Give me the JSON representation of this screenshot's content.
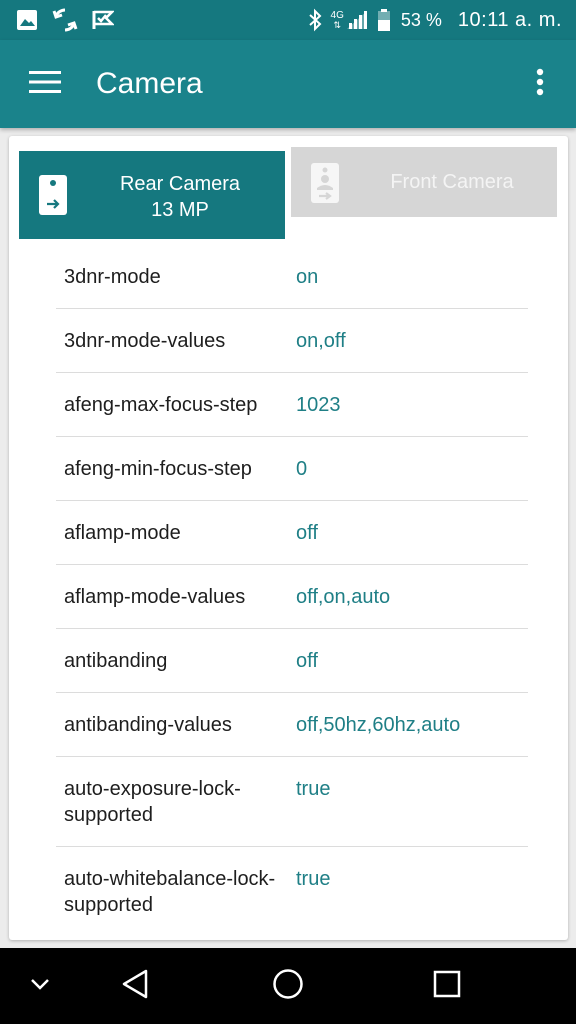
{
  "status_bar": {
    "left_icons": [
      "image-icon",
      "sync-icon",
      "check-flag-icon"
    ],
    "network_label": "4G",
    "battery_percent": "53 %",
    "time": "10:11 a. m."
  },
  "app_bar": {
    "title": "Camera",
    "menu_icon": "hamburger-menu-icon",
    "overflow_icon": "more-vert-icon"
  },
  "tabs": {
    "rear": {
      "line1": "Rear Camera",
      "line2": "13 MP",
      "selected": true
    },
    "front": {
      "line1": "Front Camera",
      "selected": false
    }
  },
  "params": [
    {
      "name": "3dnr-mode",
      "value": "on"
    },
    {
      "name": "3dnr-mode-values",
      "value": "on,off"
    },
    {
      "name": "afeng-max-focus-step",
      "value": "1023"
    },
    {
      "name": "afeng-min-focus-step",
      "value": "0"
    },
    {
      "name": "aflamp-mode",
      "value": "off"
    },
    {
      "name": "aflamp-mode-values",
      "value": "off,on,auto"
    },
    {
      "name": "antibanding",
      "value": "off"
    },
    {
      "name": "antibanding-values",
      "value": "off,50hz,60hz,auto"
    },
    {
      "name": "auto-exposure-lock-supported",
      "value": "true"
    },
    {
      "name": "auto-whitebalance-lock-supported",
      "value": "true"
    }
  ],
  "nav_bar": {
    "buttons": [
      "chevron-down-icon",
      "back-icon",
      "home-icon",
      "recents-icon"
    ]
  },
  "colors": {
    "primary": "#1a838b",
    "primary_dark": "#15787f",
    "value_text": "#1f7f86"
  }
}
